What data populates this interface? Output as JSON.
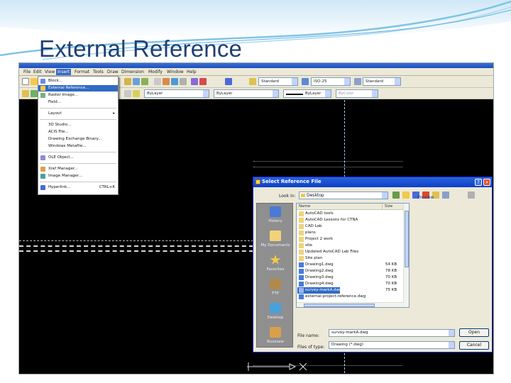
{
  "slide": {
    "title": "External Reference"
  },
  "cad": {
    "window_title": "",
    "menus": [
      "File",
      "Edit",
      "View",
      "Insert",
      "Format",
      "Tools",
      "Draw",
      "Dimension",
      "Modify",
      "Window",
      "Help"
    ],
    "active_menu": "Insert",
    "toolbar": {
      "text_style": "Standard",
      "dim_style": "ISO-25",
      "table_style": "Standard",
      "layer": "ByLayer",
      "color": "ByLayer",
      "linetype": "ByLayer",
      "lineweight": "ByLayer",
      "plotstyle": "ByColor"
    }
  },
  "insert_menu": {
    "items": [
      {
        "label": "Block...",
        "shortcut": "",
        "icon": "block-icon"
      },
      {
        "label": "External Reference...",
        "shortcut": "",
        "icon": "xref-icon",
        "selected": true
      },
      {
        "label": "Raster Image...",
        "shortcut": "",
        "icon": "image-icon"
      },
      {
        "label": "Field...",
        "shortcut": "",
        "icon": ""
      },
      {
        "label": "Layout",
        "shortcut": "▸",
        "icon": ""
      },
      {
        "label": "3D Studio...",
        "shortcut": "",
        "icon": ""
      },
      {
        "label": "ACIS File...",
        "shortcut": "",
        "icon": ""
      },
      {
        "label": "Drawing Exchange Binary...",
        "shortcut": "",
        "icon": ""
      },
      {
        "label": "Windows Metafile...",
        "shortcut": "",
        "icon": ""
      },
      {
        "label": "OLE Object...",
        "shortcut": "",
        "icon": "ole-icon"
      },
      {
        "label": "Xref Manager...",
        "shortcut": "",
        "icon": "xref-manager-icon"
      },
      {
        "label": "Image Manager...",
        "shortcut": "",
        "icon": "image-manager-icon"
      },
      {
        "label": "Hyperlink...",
        "shortcut": "CTRL+K",
        "icon": "hyperlink-icon"
      }
    ]
  },
  "dialog": {
    "title": "Select Reference File",
    "look_in_label": "Look in:",
    "look_in_value": "Desktop",
    "preview_label": "Preview",
    "columns": [
      "Name",
      "Size"
    ],
    "files": [
      {
        "name": "AutoCAD tools",
        "size": "",
        "type": "folder"
      },
      {
        "name": "AutoCAD Lessons for CTNA",
        "size": "",
        "type": "folder"
      },
      {
        "name": "CAD Lab",
        "size": "",
        "type": "folder"
      },
      {
        "name": "plans",
        "size": "",
        "type": "folder"
      },
      {
        "name": "Project 2 work",
        "size": "",
        "type": "folder"
      },
      {
        "name": "site",
        "size": "",
        "type": "folder"
      },
      {
        "name": "Updated AutoCAD Lab Files",
        "size": "",
        "type": "folder"
      },
      {
        "name": "Site plan",
        "size": "",
        "type": "folder"
      },
      {
        "name": "Drawing1.dwg",
        "size": "54 KB",
        "type": "dwg"
      },
      {
        "name": "Drawing2.dwg",
        "size": "78 KB",
        "type": "dwg"
      },
      {
        "name": "Drawing3.dwg",
        "size": "70 KB",
        "type": "dwg"
      },
      {
        "name": "Drawing4.dwg",
        "size": "70 KB",
        "type": "dwg"
      },
      {
        "name": "survey-markA.dwg",
        "size": "75 KB",
        "type": "dwg",
        "selected": true
      },
      {
        "name": "external-project-reference.dwg",
        "size": "",
        "type": "dwg"
      }
    ],
    "places": [
      {
        "label": "History",
        "icon": "history-icon"
      },
      {
        "label": "My Documents",
        "icon": "my-documents-icon"
      },
      {
        "label": "Favorites",
        "icon": "favorites-icon"
      },
      {
        "label": "FTP",
        "icon": "ftp-icon"
      },
      {
        "label": "Desktop",
        "icon": "desktop-icon"
      },
      {
        "label": "Buzzsaw",
        "icon": "buzzsaw-icon"
      }
    ],
    "file_name_label": "File name:",
    "file_name_value": "survey-markA.dwg",
    "file_type_label": "Files of type:",
    "file_type_value": "Drawing (*.dwg)",
    "open_label": "Open",
    "cancel_label": "Cancel"
  }
}
